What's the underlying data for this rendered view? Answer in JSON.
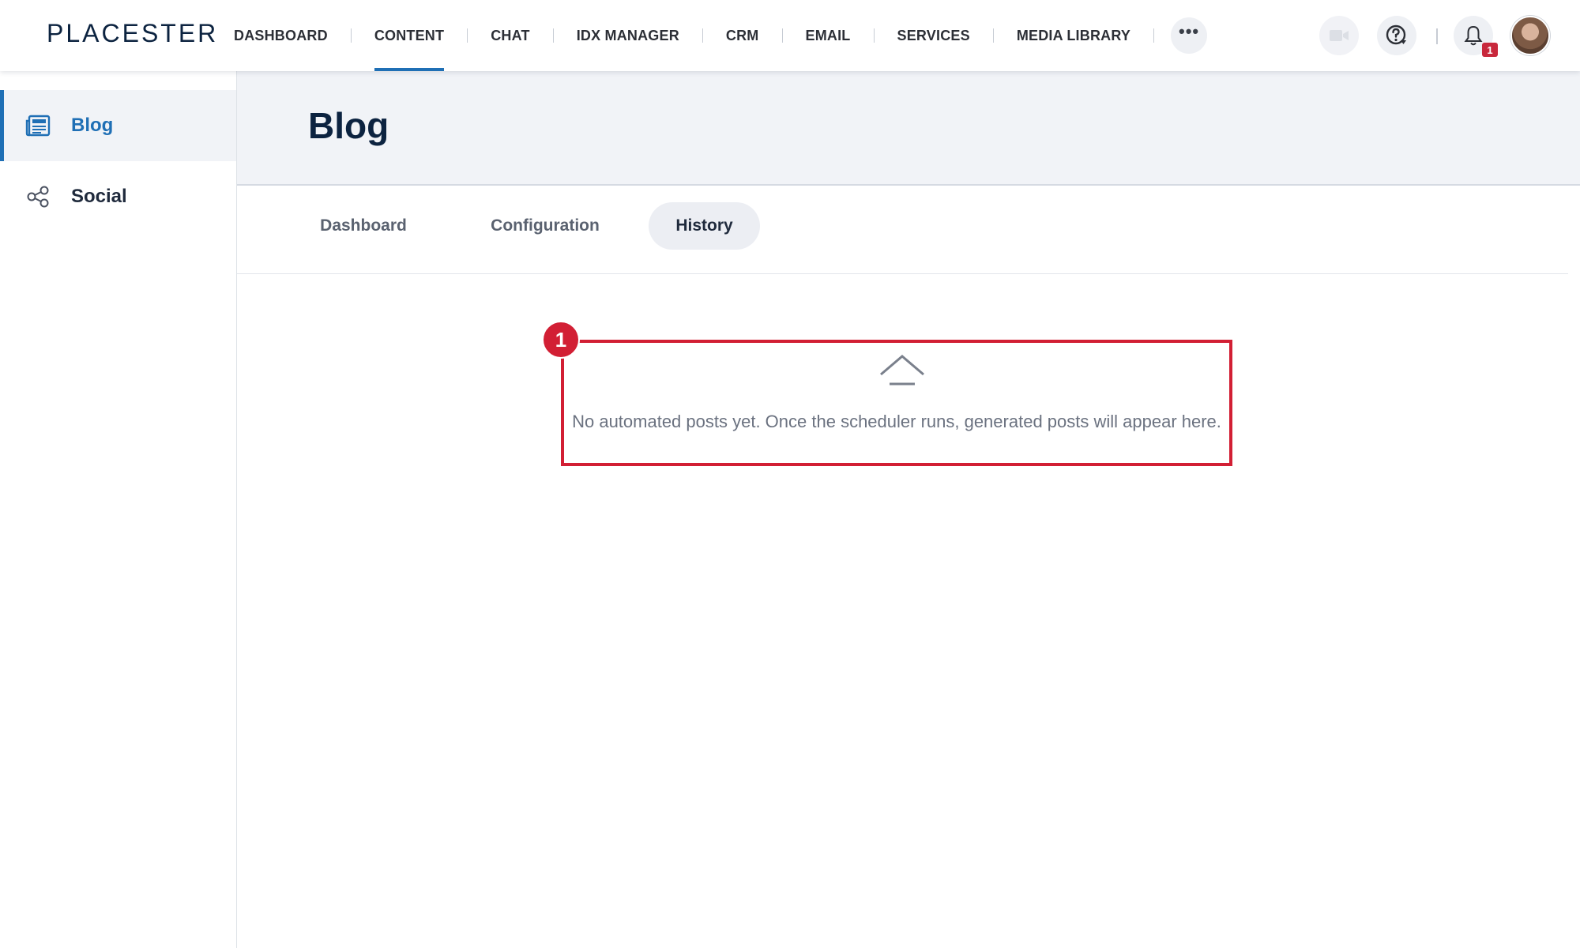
{
  "app": {
    "logo": "PLACESTER"
  },
  "nav": {
    "items": [
      {
        "label": "DASHBOARD"
      },
      {
        "label": "CONTENT"
      },
      {
        "label": "CHAT"
      },
      {
        "label": "IDX MANAGER"
      },
      {
        "label": "CRM"
      },
      {
        "label": "EMAIL"
      },
      {
        "label": "SERVICES"
      },
      {
        "label": "MEDIA LIBRARY"
      }
    ],
    "active": "CONTENT",
    "more_icon": "ellipsis-icon"
  },
  "header_actions": {
    "video_icon": "video-camera-icon",
    "help_icon": "help-circle-icon",
    "bell_icon": "bell-icon",
    "notification_count": "1"
  },
  "sidebar": {
    "items": [
      {
        "label": "Blog",
        "icon": "newspaper-icon",
        "active": true
      },
      {
        "label": "Social",
        "icon": "share-icon",
        "active": false
      }
    ]
  },
  "page": {
    "title": "Blog"
  },
  "tabs": [
    {
      "label": "Dashboard"
    },
    {
      "label": "Configuration"
    },
    {
      "label": "History",
      "active": true
    }
  ],
  "empty_state": {
    "icon": "chevron-up-icon",
    "message": "No automated posts yet. Once the scheduler runs, generated posts will appear here."
  },
  "annotation": {
    "marker": "1"
  },
  "colors": {
    "accent": "#1f6fb5",
    "brand_dark": "#0c2340",
    "highlight": "#d21f34"
  }
}
